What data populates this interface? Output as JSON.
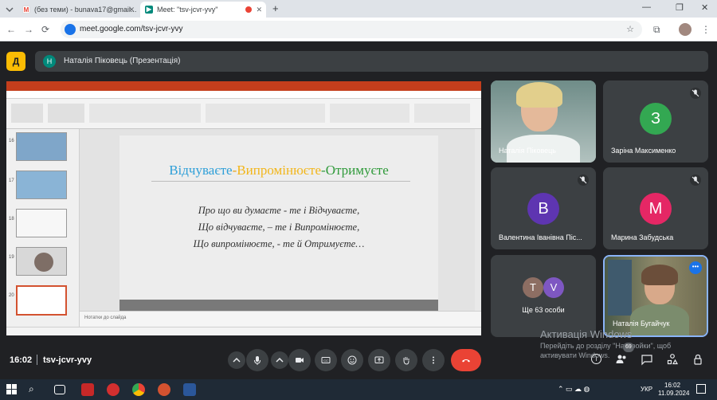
{
  "browser": {
    "tabs": [
      {
        "label": "(без теми) - bunava17@gmail...",
        "icon": "gmail-icon"
      },
      {
        "label": "Meet: \"tsv-jcvr-yvy\"",
        "icon": "meet-icon"
      }
    ],
    "url": "meet.google.com/tsv-jcvr-yvy"
  },
  "meet": {
    "presenter_initial": "Н",
    "presenter_title": "Наталія Піковець (Презентація)",
    "time": "16:02",
    "meeting_code": "tsv-jcvr-yvy",
    "accent_color": "#1a73e8",
    "end_call_color": "#ea4335"
  },
  "slide": {
    "title_part1": "Відчуваєте",
    "title_sep1": "-",
    "title_part2": "Випромінюєте",
    "title_sep2": "-",
    "title_part3": "Отримуєте",
    "line1": "Про що ви думаєте  - те і Відчуваєте,",
    "line2": "Що відчуваєте, – те і Випромінюєте,",
    "line3": "Що випромінюєте, - те й Отримуєте…",
    "notes_placeholder": "Нотатки до слайда",
    "thumb_numbers": [
      "16",
      "17",
      "18",
      "19",
      "20"
    ]
  },
  "participants": [
    {
      "name": "Наталія Піковець",
      "type": "video"
    },
    {
      "name": "Заріна Максименко",
      "initial": "З",
      "color": "#33a852",
      "muted": true
    },
    {
      "name": "Валентина Іванівна Піс...",
      "initial": "В",
      "color": "#5e35b1",
      "muted": true
    },
    {
      "name": "Марина Забудська",
      "initial": "М",
      "color": "#e52765",
      "muted": true
    },
    {
      "name": "Ще 63 особи",
      "initials": [
        "Т",
        "V"
      ]
    },
    {
      "name": "Наталія Бугайчук",
      "type": "video"
    }
  ],
  "windows_watermark": {
    "line1": "Активація Windows",
    "line2": "Перейдіть до розділу \"Настройки\", щоб",
    "line3": "активувати Windows."
  },
  "badges": {
    "people_count": "69"
  },
  "taskbar": {
    "lang": "УКР",
    "time": "16:02",
    "date": "11.09.2024"
  }
}
